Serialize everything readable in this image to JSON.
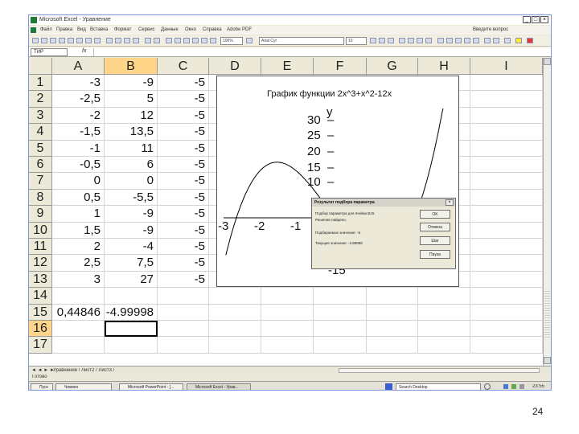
{
  "window": {
    "title": "Microsoft Excel - Уравнение",
    "controls": [
      "_",
      "□",
      "×"
    ]
  },
  "menu": [
    "Файл",
    "Правка",
    "Вид",
    "Вставка",
    "Формат",
    "Сервис",
    "Данные",
    "Окно",
    "Справка",
    "Adobe PDF"
  ],
  "help_box_placeholder": "Введите вопрос",
  "toolbar": {
    "font_name": "Arial Cyr",
    "font_size": "10",
    "zoom": "100%"
  },
  "formula_bar": {
    "name_box": "ТИР"
  },
  "sheet": {
    "columns": [
      "A",
      "B",
      "C",
      "D",
      "E",
      "F",
      "G",
      "H",
      "I"
    ],
    "rows": [
      "1",
      "2",
      "3",
      "4",
      "5",
      "6",
      "7",
      "8",
      "9",
      "10",
      "11",
      "12",
      "13",
      "14",
      "15",
      "16",
      "17"
    ],
    "col_a": [
      "-3",
      "-2,5",
      "-2",
      "-1,5",
      "-1",
      "-0,5",
      "0",
      "0,5",
      "1",
      "1,5",
      "2",
      "2,5",
      "3",
      "",
      "0,44846",
      "",
      ""
    ],
    "col_b": [
      "-9",
      "5",
      "12",
      "13,5",
      "11",
      "6",
      "0",
      "-5,5",
      "-9",
      "-9",
      "-4",
      "7,5",
      "27",
      "",
      "-4.99998",
      "",
      ""
    ],
    "col_c": [
      "-5",
      "-5",
      "-5",
      "-5",
      "-5",
      "-5",
      "-5",
      "-5",
      "-5",
      "-5",
      "-5",
      "-5",
      "-5",
      "",
      "",
      "",
      ""
    ],
    "selected_row": "16"
  },
  "chart_data": {
    "type": "line",
    "title": "График функции 2x^3+x^2-12x",
    "ylabel": "y",
    "y_ticks_visible": [
      "30",
      "25",
      "20",
      "15",
      "10"
    ],
    "y_ticks_lower": [
      "-1",
      "-15"
    ],
    "x_ticks_visible": [
      "-3",
      "-2",
      "-1"
    ],
    "x": [
      -3,
      -2.5,
      -2,
      -1.5,
      -1,
      -0.5,
      0,
      0.5,
      1,
      1.5,
      2,
      2.5,
      3
    ],
    "series": [
      {
        "values": [
          -9,
          5,
          12,
          13.5,
          11,
          6,
          0,
          -5.5,
          -9,
          -9,
          -4,
          7.5,
          27
        ]
      }
    ],
    "xlim": [
      -3,
      3
    ],
    "ylim": [
      -15,
      30
    ]
  },
  "dialog": {
    "title": "Результат подбора параметра",
    "lines": [
      "Подбор параметра для ячейки B15.",
      "Решение найдено.",
      "Подбираемое значение:   -5",
      "Текущее значение:         -4,99998"
    ],
    "buttons": [
      "OK",
      "Отмена",
      "Шаг",
      "Пауза"
    ]
  },
  "sheet_tabs": "Уравнение / Лист2 / Лист3 /",
  "status_text": "Готово",
  "taskbar": {
    "start": "Пуск",
    "items": [
      "Чекмен",
      "Microsoft PowerPoint - [...",
      "Microsoft Excel - Урав..."
    ],
    "search_placeholder": "Search Desktop",
    "clock": "23:55"
  },
  "page_number": "24"
}
